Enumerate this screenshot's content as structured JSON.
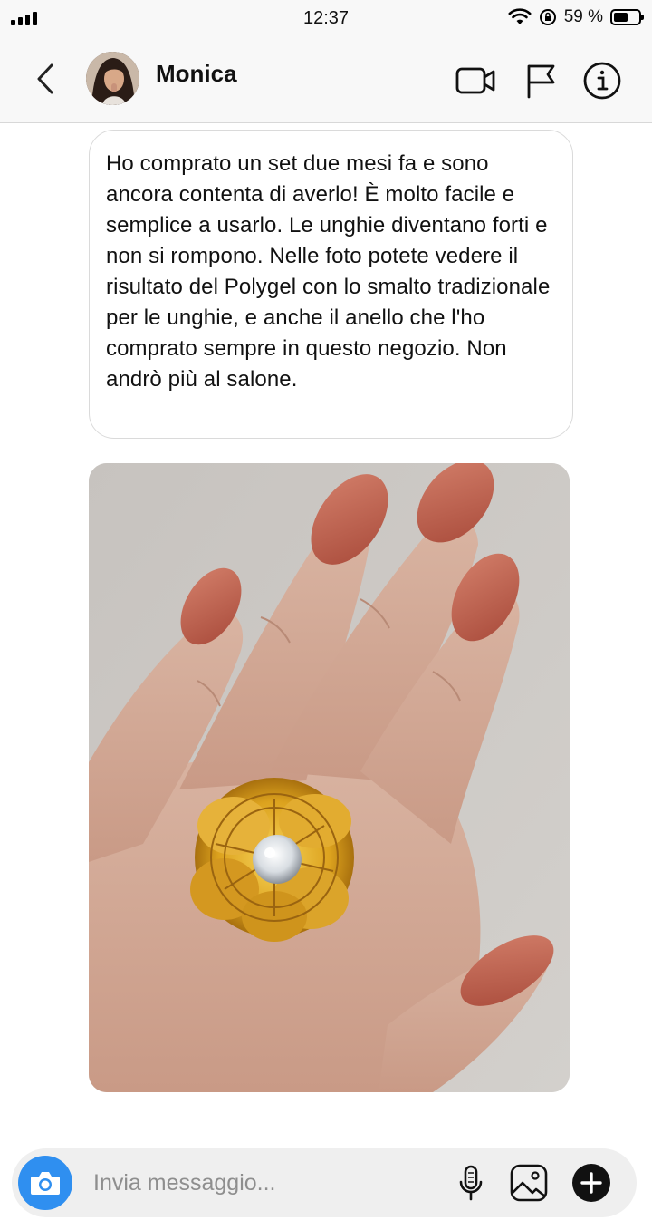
{
  "status_bar": {
    "time": "12:37",
    "battery_text": "59 %",
    "battery_level": 0.59,
    "icons": [
      "signal-icon",
      "wifi-icon",
      "orientation-lock-icon",
      "battery-icon"
    ]
  },
  "header": {
    "contact_name": "Monica",
    "icons": [
      "back-icon",
      "video-call-icon",
      "flag-icon",
      "info-icon"
    ]
  },
  "message": {
    "text": "Ho comprato un set due mesi fa e sono ancora contenta di averlo! È molto facile e semplice a usarlo. Le unghie diventano forti e non si rompono. Nelle foto potete vedere il risultato del Polygel con lo smalto tradizionale per le unghie, e anche il anello che l'ho comprato sempre in questo negozio. Non andrò più al salone."
  },
  "composer": {
    "placeholder": "Invia messaggio...",
    "icons": [
      "camera-icon",
      "microphone-icon",
      "gallery-icon",
      "plus-icon"
    ]
  },
  "colors": {
    "accent": "#2f8ff0",
    "nail": "#b85a4a",
    "gold": "#d9a020"
  }
}
